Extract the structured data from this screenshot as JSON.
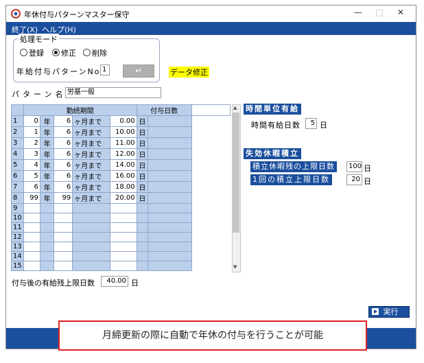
{
  "window": {
    "title": "年休付与パターンマスター保守",
    "icon": "app-icon",
    "controls": {
      "minimize": "—",
      "maximize": "□",
      "close": "✕"
    }
  },
  "menu": {
    "items": [
      "終了(X)",
      "ヘルプ(H)"
    ]
  },
  "mode": {
    "group_label": "処理モード",
    "options": [
      "登録",
      "修正",
      "削除"
    ],
    "selected_index": 1,
    "pattern_no_label": "年給付与パターンNo.",
    "pattern_no_value": "1",
    "enter_key_glyph": "↵",
    "status_text": "データ修正"
  },
  "pattern_name": {
    "label": "パターン名",
    "value": "労基一般"
  },
  "table": {
    "headers": {
      "period": "勤続期間",
      "days": "付与日数"
    },
    "rows": [
      {
        "n": "1",
        "y": "0",
        "yu": "年",
        "m": "6",
        "mu": "ヶ月まで",
        "d": "0.00",
        "du": "日"
      },
      {
        "n": "2",
        "y": "1",
        "yu": "年",
        "m": "6",
        "mu": "ヶ月まで",
        "d": "10.00",
        "du": "日"
      },
      {
        "n": "3",
        "y": "2",
        "yu": "年",
        "m": "6",
        "mu": "ヶ月まで",
        "d": "11.00",
        "du": "日"
      },
      {
        "n": "4",
        "y": "3",
        "yu": "年",
        "m": "6",
        "mu": "ヶ月まで",
        "d": "12.00",
        "du": "日"
      },
      {
        "n": "5",
        "y": "4",
        "yu": "年",
        "m": "6",
        "mu": "ヶ月まで",
        "d": "14.00",
        "du": "日"
      },
      {
        "n": "6",
        "y": "5",
        "yu": "年",
        "m": "6",
        "mu": "ヶ月まで",
        "d": "16.00",
        "du": "日"
      },
      {
        "n": "7",
        "y": "6",
        "yu": "年",
        "m": "6",
        "mu": "ヶ月まで",
        "d": "18.00",
        "du": "日"
      },
      {
        "n": "8",
        "y": "99",
        "yu": "年",
        "m": "99",
        "mu": "ヶ月まで",
        "d": "20.00",
        "du": "日"
      },
      {
        "n": "9",
        "y": "",
        "yu": "",
        "m": "",
        "mu": "",
        "d": "",
        "du": ""
      },
      {
        "n": "10",
        "y": "",
        "yu": "",
        "m": "",
        "mu": "",
        "d": "",
        "du": ""
      },
      {
        "n": "11",
        "y": "",
        "yu": "",
        "m": "",
        "mu": "",
        "d": "",
        "du": ""
      },
      {
        "n": "12",
        "y": "",
        "yu": "",
        "m": "",
        "mu": "",
        "d": "",
        "du": ""
      },
      {
        "n": "13",
        "y": "",
        "yu": "",
        "m": "",
        "mu": "",
        "d": "",
        "du": ""
      },
      {
        "n": "14",
        "y": "",
        "yu": "",
        "m": "",
        "mu": "",
        "d": "",
        "du": ""
      },
      {
        "n": "15",
        "y": "",
        "yu": "",
        "m": "",
        "mu": "",
        "d": "",
        "du": ""
      }
    ],
    "scroll_up": "▲",
    "scroll_down": "▼"
  },
  "after_grant": {
    "label": "付与後の有給残上限日数",
    "value": "40.00",
    "unit": "日"
  },
  "hourly": {
    "title": "時間単位有給",
    "days_label": "時間有給日数",
    "days_value": "5",
    "days_unit": "日"
  },
  "expired": {
    "title": "失効休暇積立",
    "total_label": "積立休暇残の上限日数",
    "total_value": "100",
    "total_unit": "日",
    "once_label": "1回の積立上限日数",
    "once_value": "20",
    "once_unit": "日"
  },
  "execute_button": {
    "icon": "play-icon",
    "label": "実行"
  },
  "notice": "月締更新の際に自動で年休の付与を行うことが可能",
  "colors": {
    "accent": "#1b4f9e",
    "grid_blue": "#bcd0ec",
    "status_bg": "#ffff00",
    "notice_border": "#e02020"
  }
}
